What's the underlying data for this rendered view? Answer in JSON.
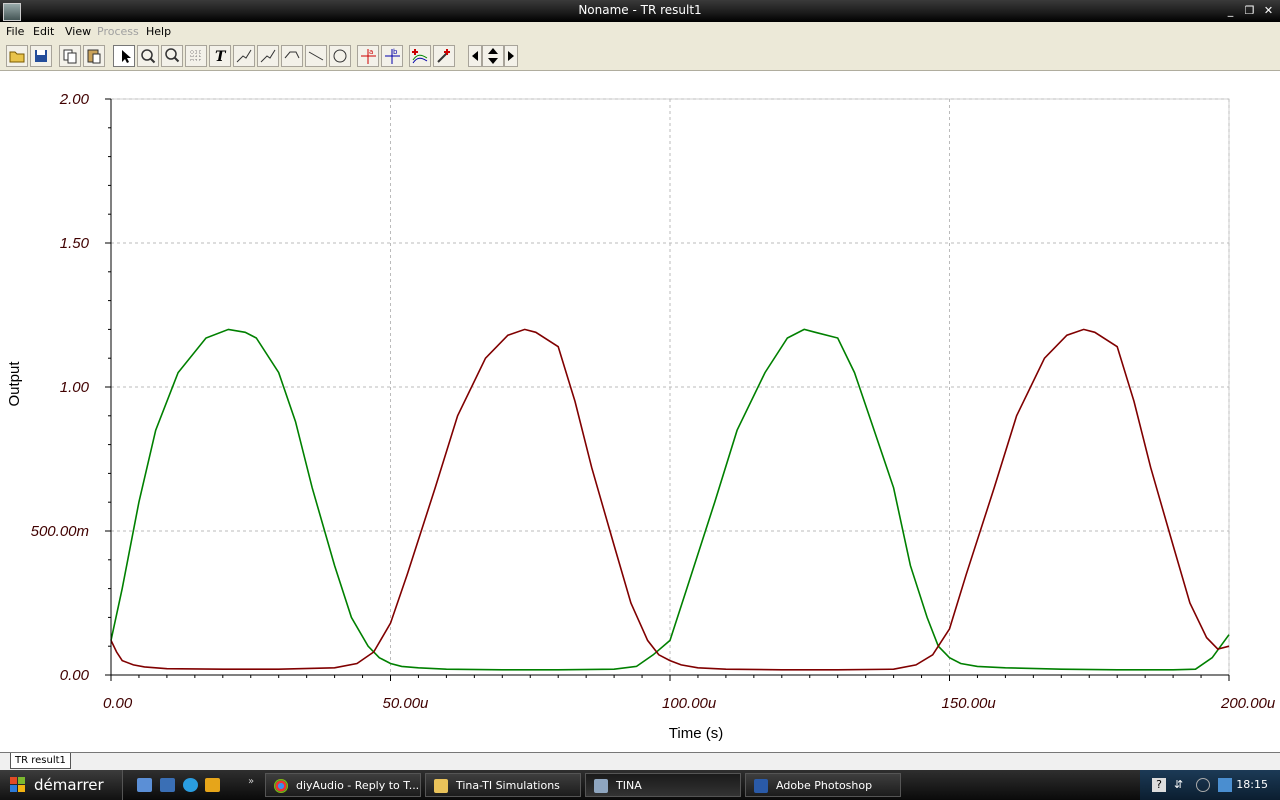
{
  "window": {
    "title": "Noname - TR result1",
    "minimize": "_",
    "restore": "❐",
    "close": "✕"
  },
  "menu": {
    "file": "File",
    "edit": "Edit",
    "view": "View",
    "process": "Process",
    "help": "Help"
  },
  "toolbar": {
    "icons": [
      "open-folder-icon",
      "save-icon",
      "copy-icon",
      "paste-icon",
      "pointer-icon",
      "zoom-in-icon",
      "zoom-100-icon",
      "grid-icon",
      "text-icon",
      "curve-label-icon",
      "curve-label-2-icon",
      "curve-label-3-icon",
      "line-icon",
      "circle-icon",
      "cursor-a-icon",
      "cursor-b-icon",
      "add-curve-icon",
      "probe-icon",
      "left-arrow-icon",
      "up-down-icon",
      "right-arrow-icon"
    ]
  },
  "chart_data": {
    "type": "line",
    "xlabel": "Time (s)",
    "ylabel": "Output",
    "xlim": [
      0,
      0.0002
    ],
    "ylim": [
      0,
      2
    ],
    "xticks": [
      0,
      5e-05,
      0.0001,
      0.00015,
      0.0002
    ],
    "xtick_labels": [
      "0.00",
      "50.00u",
      "100.00u",
      "150.00u",
      "200.00u"
    ],
    "yticks": [
      0,
      0.5,
      1,
      1.5,
      2
    ],
    "ytick_labels": [
      "0.00",
      "500.00m",
      "1.00",
      "1.50",
      "2.00"
    ],
    "grid": true,
    "series": [
      {
        "color": "#008000",
        "x": [
          0,
          2,
          5,
          8,
          12,
          17,
          21,
          24,
          26,
          30,
          33,
          36,
          40,
          43,
          46,
          48,
          50,
          52,
          55,
          60,
          70,
          80,
          90,
          94,
          97,
          100,
          103,
          108,
          112,
          117,
          121,
          124,
          126,
          130,
          133,
          136,
          140,
          143,
          146,
          148,
          150,
          152,
          155,
          160,
          170,
          180,
          190,
          194,
          197,
          200
        ],
        "y": [
          0.12,
          0.3,
          0.6,
          0.85,
          1.05,
          1.17,
          1.2,
          1.19,
          1.17,
          1.05,
          0.88,
          0.65,
          0.38,
          0.2,
          0.1,
          0.06,
          0.04,
          0.03,
          0.025,
          0.02,
          0.018,
          0.018,
          0.02,
          0.03,
          0.07,
          0.12,
          0.3,
          0.6,
          0.85,
          1.05,
          1.17,
          1.2,
          1.19,
          1.17,
          1.05,
          0.88,
          0.65,
          0.38,
          0.2,
          0.1,
          0.06,
          0.04,
          0.03,
          0.025,
          0.02,
          0.018,
          0.018,
          0.02,
          0.06,
          0.14
        ]
      },
      {
        "color": "#800000",
        "x": [
          0,
          1,
          2,
          4,
          6,
          10,
          20,
          30,
          40,
          44,
          47,
          50,
          53,
          58,
          62,
          67,
          71,
          74,
          76,
          80,
          83,
          86,
          90,
          93,
          96,
          98,
          100,
          102,
          105,
          110,
          120,
          130,
          140,
          144,
          147,
          150,
          153,
          158,
          162,
          167,
          171,
          174,
          176,
          180,
          183,
          186,
          190,
          193,
          196,
          198,
          200
        ],
        "y": [
          0.12,
          0.08,
          0.05,
          0.035,
          0.028,
          0.022,
          0.02,
          0.02,
          0.025,
          0.04,
          0.08,
          0.18,
          0.35,
          0.65,
          0.9,
          1.1,
          1.18,
          1.2,
          1.19,
          1.14,
          0.95,
          0.72,
          0.45,
          0.25,
          0.12,
          0.07,
          0.05,
          0.035,
          0.025,
          0.02,
          0.018,
          0.018,
          0.02,
          0.035,
          0.07,
          0.16,
          0.35,
          0.65,
          0.9,
          1.1,
          1.18,
          1.2,
          1.19,
          1.14,
          0.95,
          0.72,
          0.45,
          0.25,
          0.13,
          0.09,
          0.1
        ]
      }
    ]
  },
  "tab": {
    "label": "TR result1"
  },
  "taskbar": {
    "start": "démarrer",
    "tasks": [
      "diyAudio - Reply to T...",
      "Tina-TI Simulations",
      "TINA",
      "Adobe Photoshop"
    ],
    "clock": "18:15"
  },
  "colors": {
    "series1": "#008000",
    "series2": "#800000",
    "grid": "#bbbbbb",
    "axis": "#000000"
  }
}
